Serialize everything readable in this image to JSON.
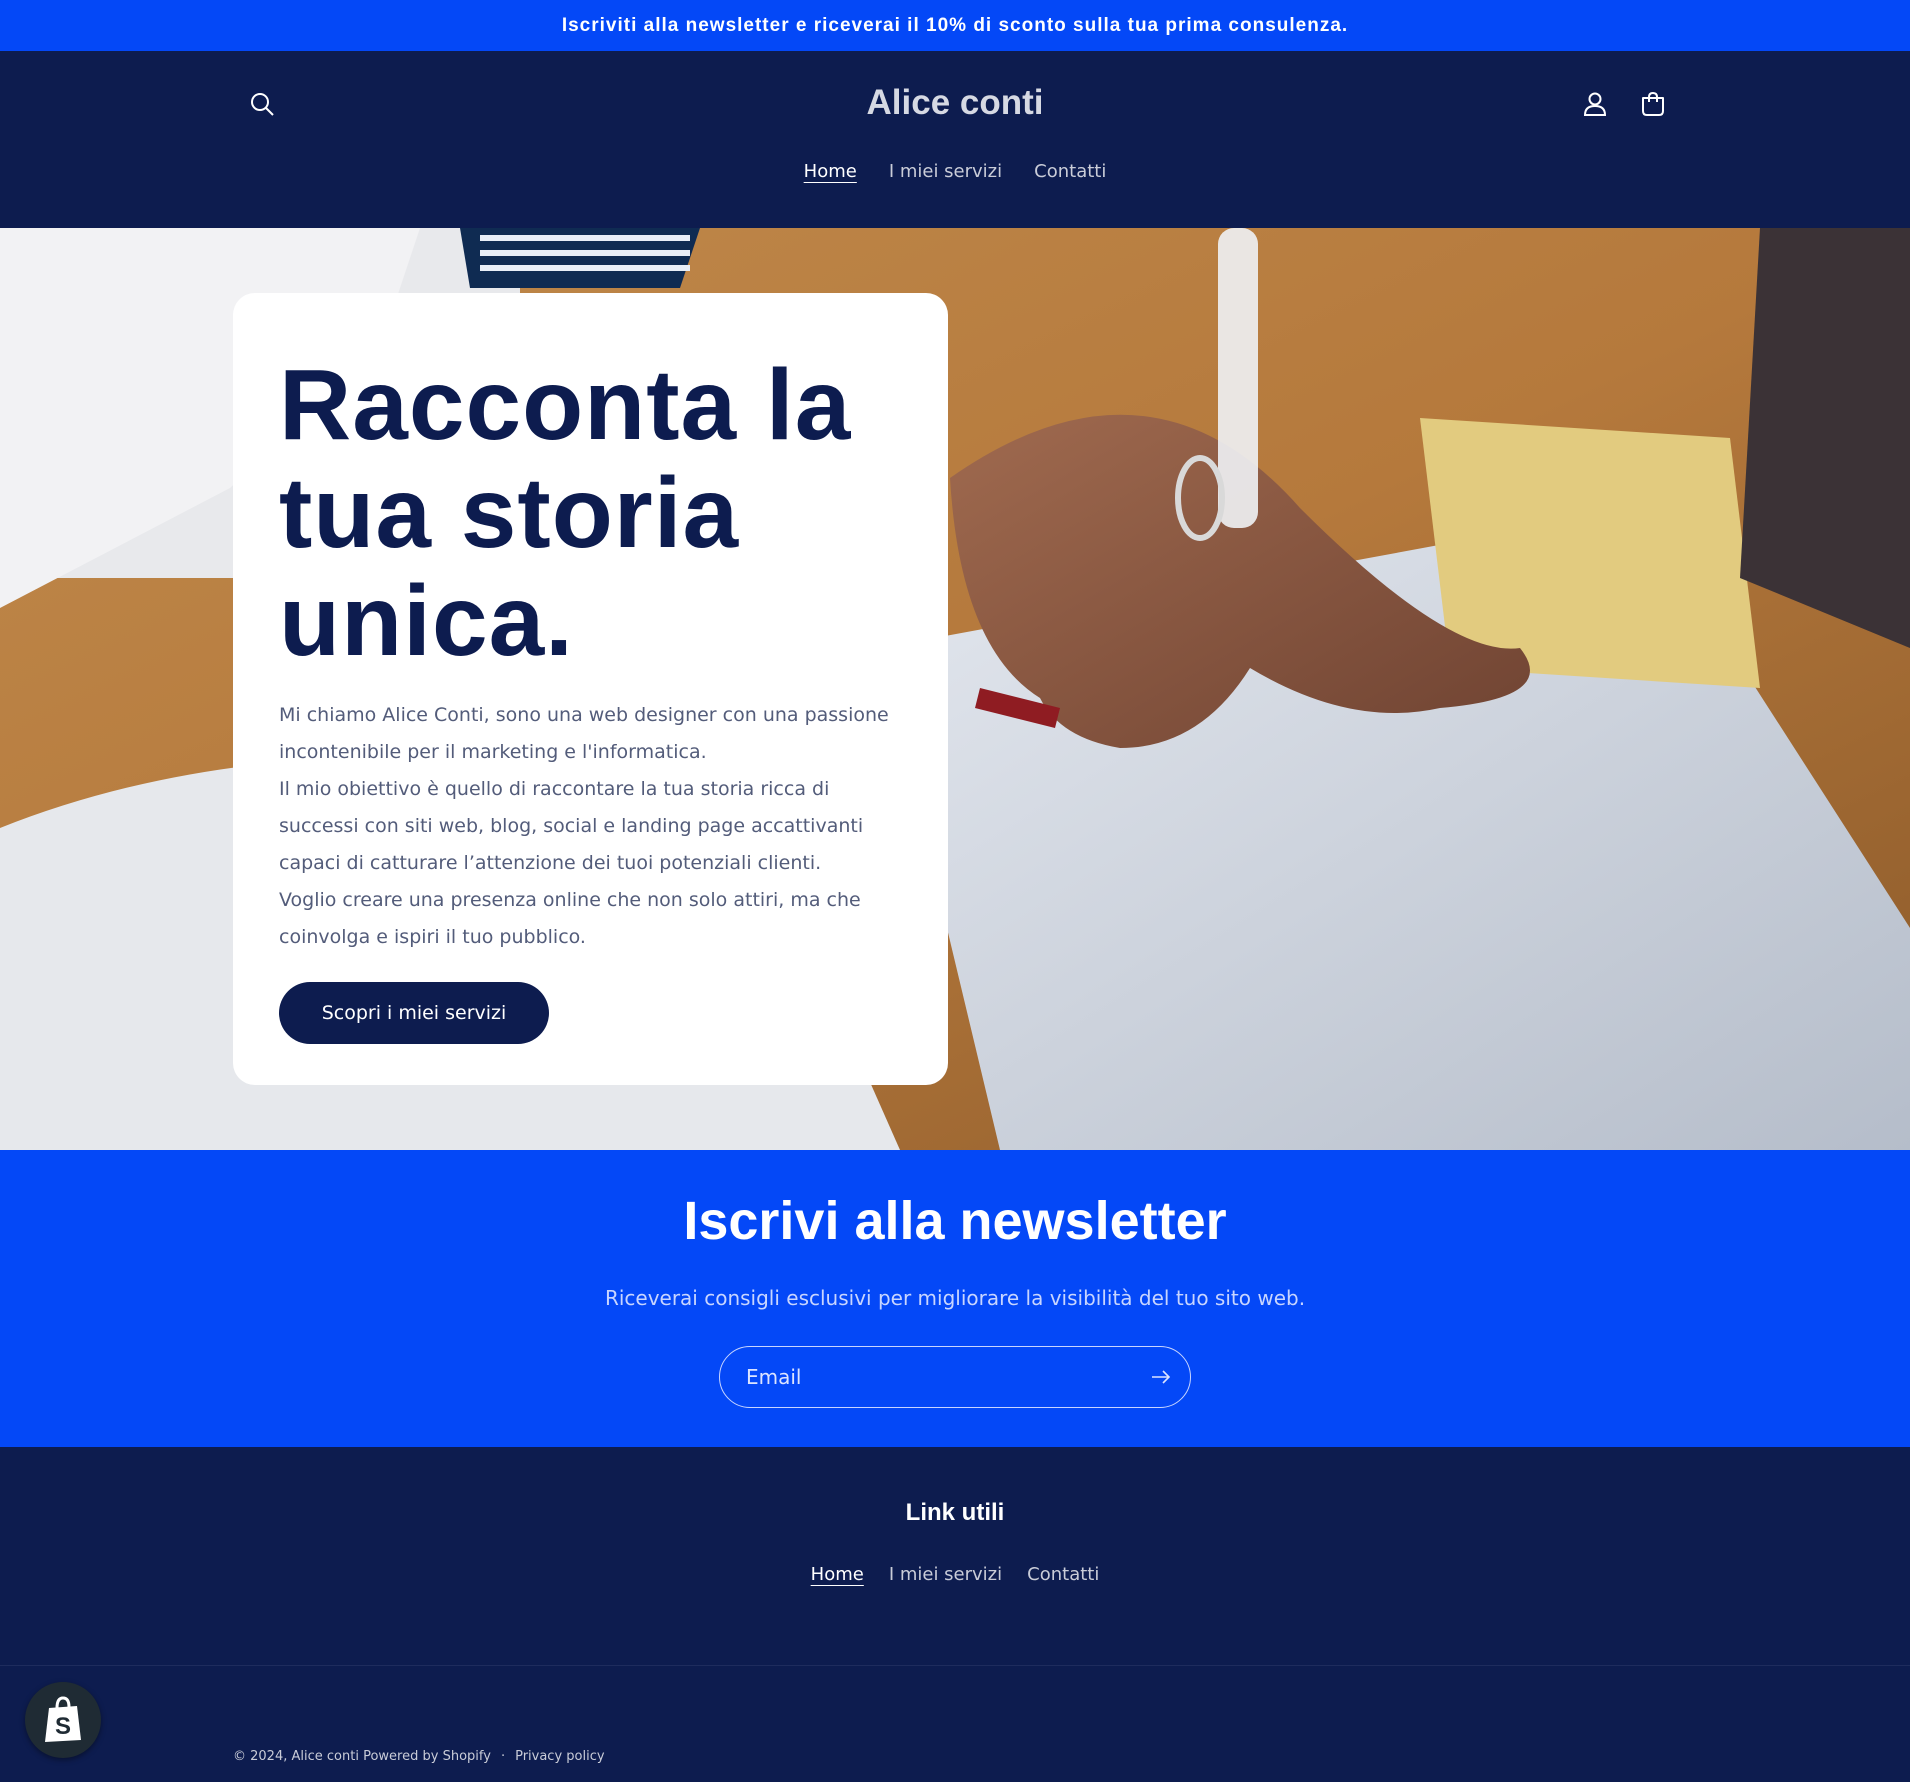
{
  "announcement": {
    "text": "Iscriviti alla newsletter e riceverai il 10% di sconto sulla tua prima consulenza."
  },
  "header": {
    "logo": "Alice conti",
    "nav": [
      {
        "label": "Home",
        "active": true
      },
      {
        "label": "I miei servizi",
        "active": false
      },
      {
        "label": "Contatti",
        "active": false
      }
    ],
    "icons": [
      "search-icon",
      "account-icon",
      "cart-icon"
    ]
  },
  "hero": {
    "title": "Racconta la tua storia unica.",
    "description": [
      "Mi chiamo Alice Conti, sono una web designer con una passione incontenibile per il marketing e l'informatica.",
      "Il mio obiettivo è quello di raccontare la tua storia ricca di successi con siti web, blog, social e landing page accattivanti capaci di catturare l’attenzione dei tuoi potenziali clienti.",
      "Voglio creare una presenza online che non solo attiri, ma che coinvolga e ispiri il tuo pubblico."
    ],
    "cta": "Scopri i miei servizi"
  },
  "newsletter": {
    "title": "Iscrivi alla newsletter",
    "subtitle": "Riceverai consigli esclusivi per migliorare la visibilità del tuo sito web.",
    "email_placeholder": "Email"
  },
  "footer": {
    "title": "Link utili",
    "nav": [
      {
        "label": "Home",
        "active": true
      },
      {
        "label": "I miei servizi",
        "active": false
      },
      {
        "label": "Contatti",
        "active": false
      }
    ],
    "copyright": "© 2024,",
    "brand_link": "Alice conti",
    "powered": "Powered by Shopify",
    "separator": "·",
    "privacy": "Privacy policy"
  },
  "colors": {
    "accent_blue": "#0448f7",
    "navy": "#0d1c4f",
    "white": "#ffffff"
  }
}
